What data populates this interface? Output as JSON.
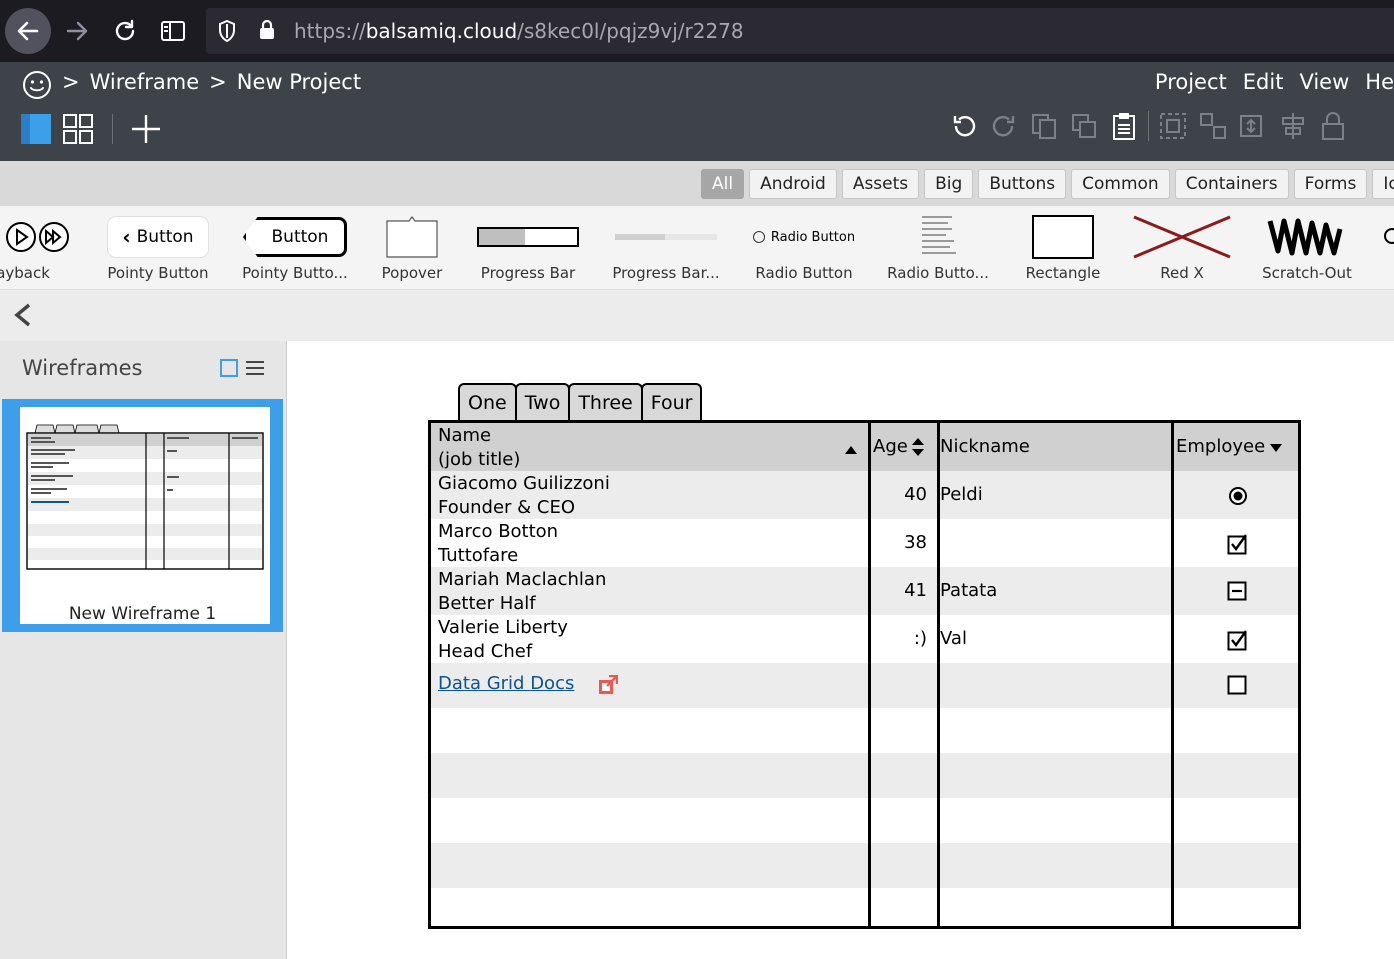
{
  "browser": {
    "url_scheme": "https://",
    "url_host": "balsamiq.cloud",
    "url_path": "/s8kec0l/pqjz9vj/r2278"
  },
  "app": {
    "breadcrumb": [
      ">",
      "Wireframe",
      ">",
      "New Project"
    ],
    "menus": [
      "Project",
      "Edit",
      "View",
      "He"
    ]
  },
  "library": {
    "filters": [
      "All",
      "Android",
      "Assets",
      "Big",
      "Buttons",
      "Common",
      "Containers",
      "Forms",
      "Ico"
    ],
    "components": [
      {
        "label": "layback",
        "icon": "playback-icon"
      },
      {
        "label": "Pointy Button",
        "thumb_text": "Button",
        "icon": "pointy-button-icon"
      },
      {
        "label": "Pointy Butto...",
        "thumb_text": "Button",
        "icon": "pointy-button-alt-icon"
      },
      {
        "label": "Popover",
        "icon": "popover-icon"
      },
      {
        "label": "Progress Bar",
        "icon": "progress-bar-icon"
      },
      {
        "label": "Progress Bar...",
        "icon": "progress-bar-alt-icon"
      },
      {
        "label": "Radio Button",
        "thumb_text": "Radio Button",
        "icon": "radio-button-icon"
      },
      {
        "label": "Radio Butto...",
        "icon": "radio-button-group-icon"
      },
      {
        "label": "Rectangle",
        "icon": "rectangle-icon"
      },
      {
        "label": "Red X",
        "icon": "red-x-icon"
      },
      {
        "label": "Scratch-Out",
        "icon": "scratch-out-icon"
      }
    ]
  },
  "sidebar": {
    "title": "Wireframes",
    "wireframes": [
      {
        "name": "New Wireframe 1",
        "selected": true
      }
    ]
  },
  "grid": {
    "tabs": [
      "One",
      "Two",
      "Three",
      "Four"
    ],
    "headers": {
      "name_line1": "Name",
      "name_line2": "(job title)",
      "age": "Age",
      "nickname": "Nickname",
      "employee": "Employee"
    },
    "rows": [
      {
        "name": "Giacomo Guilizzoni",
        "title": "Founder & CEO",
        "age": "40",
        "nickname": "Peldi",
        "employee": "radio-selected"
      },
      {
        "name": "Marco Botton",
        "title": "Tuttofare",
        "age": "38",
        "nickname": "",
        "employee": "checked"
      },
      {
        "name": "Mariah Maclachlan",
        "title": "Better Half",
        "age": "41",
        "nickname": "Patata",
        "employee": "indeterminate"
      },
      {
        "name": "Valerie Liberty",
        "title": "Head Chef",
        "age": ":)",
        "nickname": "Val",
        "employee": "checked"
      }
    ],
    "link_row": {
      "text": "Data Grid Docs",
      "employee": "unchecked"
    },
    "colors": {
      "header_bg": "#d0d0d0",
      "alt_row_bg": "#ececec",
      "link": "#0b5394",
      "external_icon": "#e8594f"
    }
  },
  "colors": {
    "browser_bg": "#1c1b22",
    "app_header": "#3d4349",
    "accent": "#3d9ee9",
    "red_x": "#8b1a1a"
  }
}
